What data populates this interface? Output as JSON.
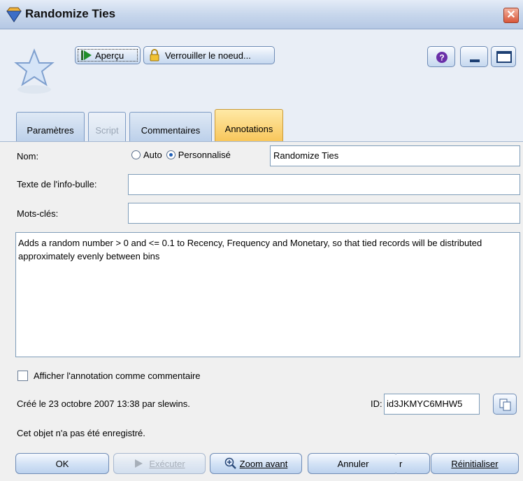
{
  "window": {
    "title": "Randomize Ties"
  },
  "toolbar": {
    "preview_label": "Aperçu",
    "lock_label": "Verrouiller le noeud..."
  },
  "tabs": [
    {
      "label": "Paramètres",
      "state": "normal"
    },
    {
      "label": "Script",
      "state": "disabled"
    },
    {
      "label": "Commentaires",
      "state": "normal"
    },
    {
      "label": "Annotations",
      "state": "active"
    }
  ],
  "form": {
    "name_label": "Nom:",
    "auto_label": "Auto",
    "custom_label": "Personnalisé",
    "name_value": "Randomize Ties",
    "tooltip_label": "Texte de l'info-bulle:",
    "tooltip_value": "",
    "keywords_label": "Mots-clés:",
    "keywords_value": "",
    "annotation_text": "Adds a random number > 0 and <= 0.1 to Recency, Frequency and Monetary, so that tied records will be distributed approximately evenly between bins",
    "show_as_comment_label": "Afficher l'annotation comme commentaire",
    "created_text": "Créé le 23 octobre 2007 13:38 par slewins.",
    "id_label": "ID:",
    "id_value": "id3JKMYC6MHW5",
    "not_saved_text": "Cet objet n'a pas été enregistré."
  },
  "buttons": {
    "ok": "OK",
    "run": "Exécuter",
    "zoom_in": "Zoom avant",
    "cancel": "Annuler",
    "apply_fragment": "r",
    "reset": "Réinitialiser"
  },
  "colors": {
    "active_tab": "#f8c65b",
    "window_accent": "#c8d7ec"
  }
}
